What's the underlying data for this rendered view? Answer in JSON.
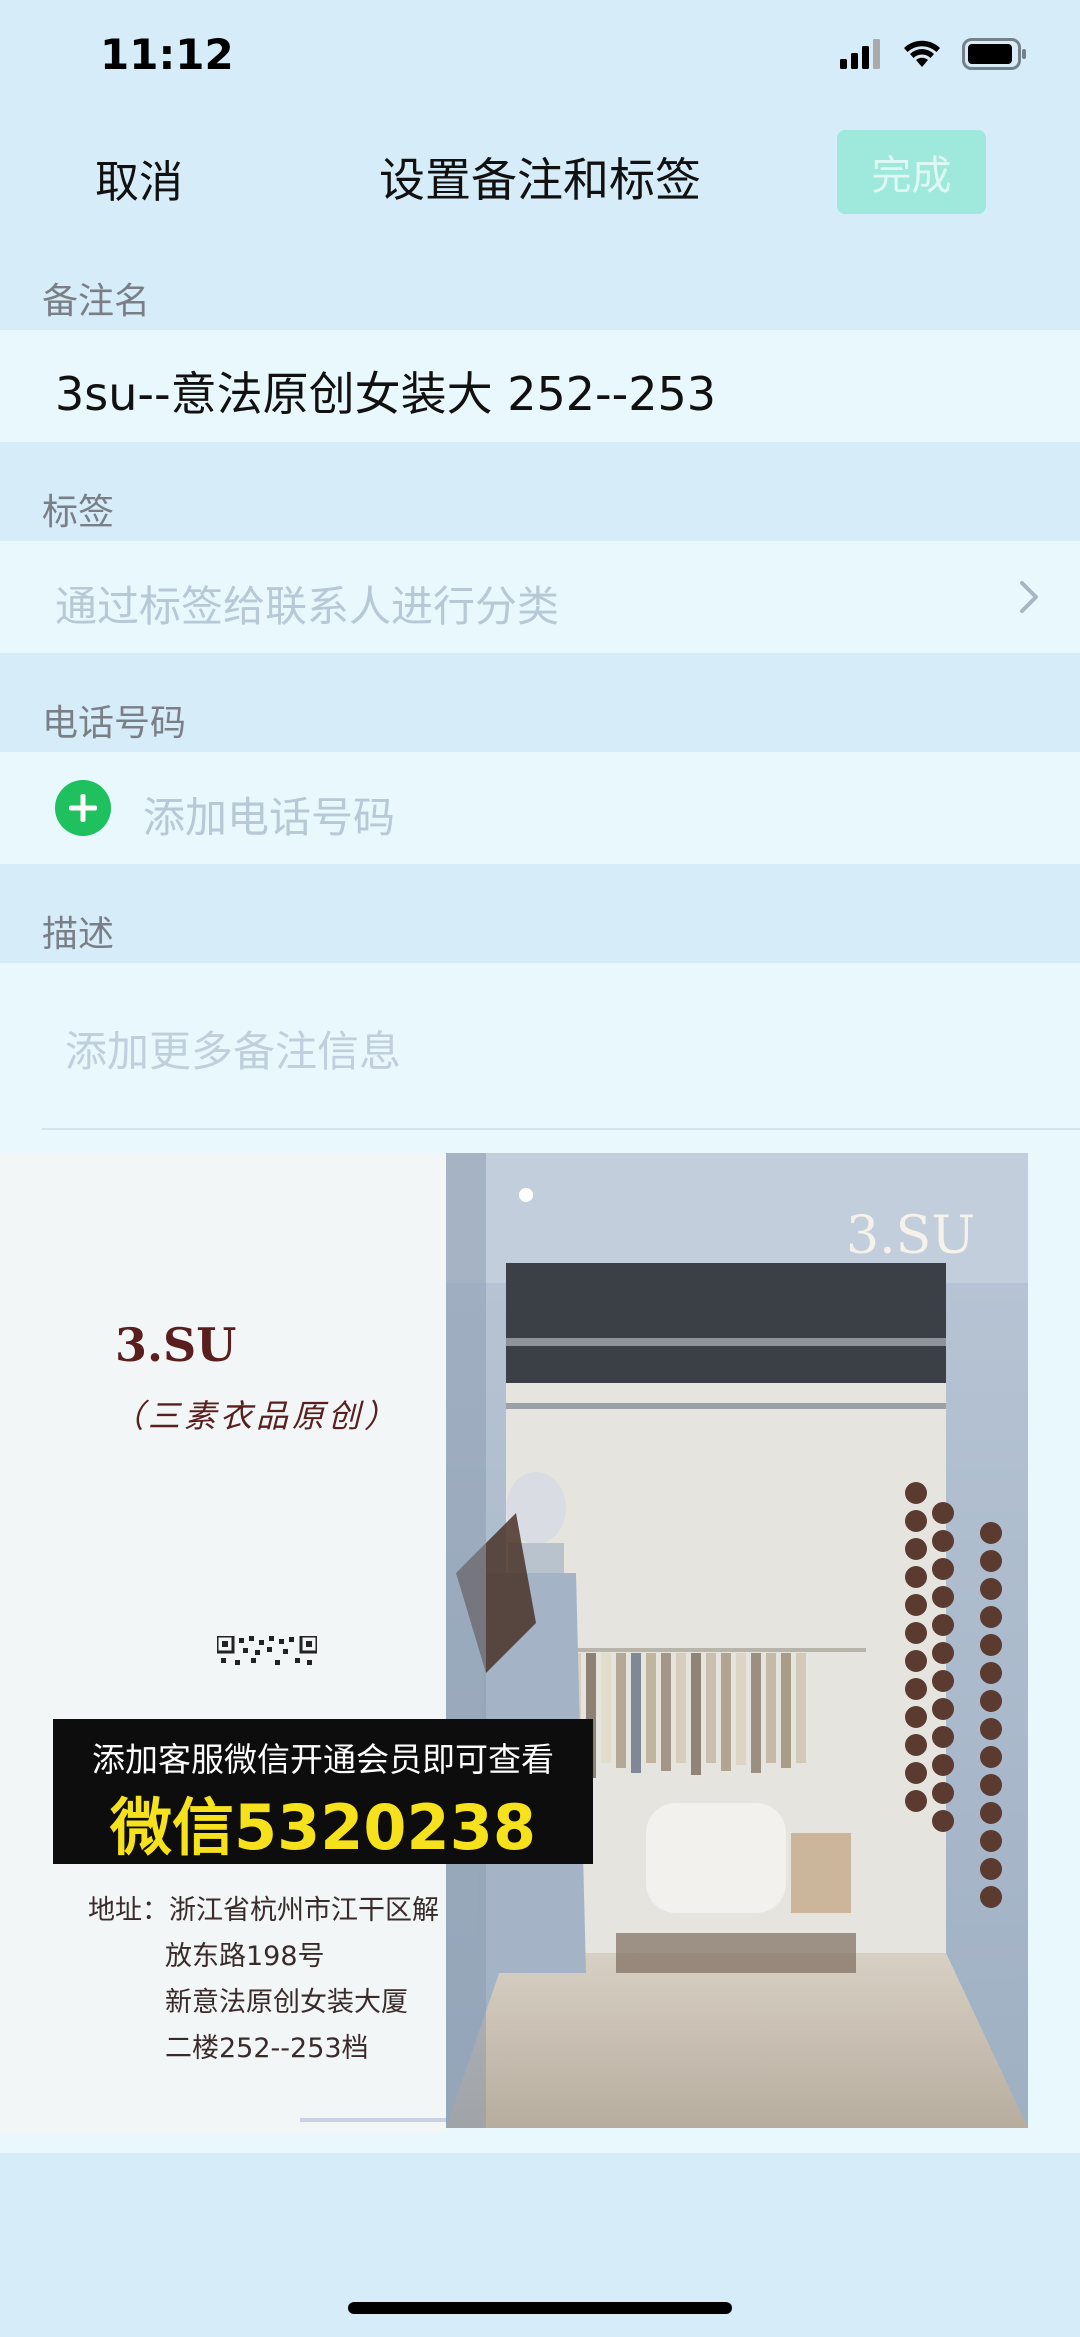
{
  "status_bar": {
    "time": "11:12"
  },
  "nav": {
    "cancel_label": "取消",
    "title": "设置备注和标签",
    "done_label": "完成"
  },
  "remark": {
    "label": "备注名",
    "value": "3su--意法原创女装大 252--253"
  },
  "tags": {
    "label": "标签",
    "placeholder": "通过标签给联系人进行分类"
  },
  "phone": {
    "label": "电话号码",
    "placeholder": "添加电话号码"
  },
  "description": {
    "label": "描述",
    "placeholder": "添加更多备注信息"
  },
  "card": {
    "brand": "3.SU",
    "brand_sub": "（三素衣品原创）",
    "promo_line1": "添加客服微信开通会员即可查看",
    "promo_line2": "微信5320238",
    "address": [
      "地址：浙江省杭州市江干区解",
      "放东路198号",
      "新意法原创女装大厦",
      "二楼252--253档"
    ],
    "store_sign": "3.SU"
  },
  "colors": {
    "background": "#d6ecf8",
    "row_background": "#e8f8fc",
    "done_button": "#9ee8dc",
    "add_icon": "#1fc05e",
    "promo_text": "#f5e11c"
  }
}
